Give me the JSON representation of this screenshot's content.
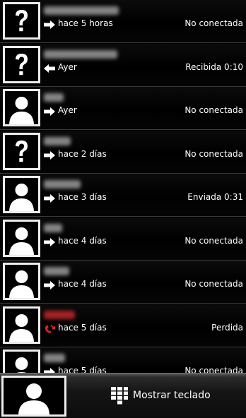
{
  "calls": [
    {
      "avatar": "unknown-contact-icon",
      "direction": "outgoing-call-icon",
      "time": "hace 5 horas",
      "status": "No conectada",
      "missed": false
    },
    {
      "avatar": "unknown-contact-icon",
      "direction": "incoming-call-icon",
      "time": "Ayer",
      "status": "Recibida 0:10",
      "missed": false
    },
    {
      "avatar": "person-silhouette-icon",
      "direction": "outgoing-call-icon",
      "time": "Ayer",
      "status": "No conectada",
      "missed": false
    },
    {
      "avatar": "unknown-contact-icon",
      "direction": "outgoing-call-icon",
      "time": "hace 2 días",
      "status": "No conectada",
      "missed": false
    },
    {
      "avatar": "person-silhouette-icon",
      "direction": "outgoing-call-icon",
      "time": "hace 3 días",
      "status": "Enviada 0:31",
      "missed": false
    },
    {
      "avatar": "person-silhouette-icon",
      "direction": "outgoing-call-icon",
      "time": "hace 4 días",
      "status": "No conectada",
      "missed": false
    },
    {
      "avatar": "person-silhouette-icon",
      "direction": "outgoing-call-icon",
      "time": "hace 4 días",
      "status": "No conectada",
      "missed": false
    },
    {
      "avatar": "person-silhouette-icon",
      "direction": "missed-call-icon",
      "time": "hace 5 días",
      "status": "Perdida",
      "missed": true
    },
    {
      "avatar": "person-silhouette-icon",
      "direction": "outgoing-call-icon",
      "time": "hace 5 días",
      "status": "No conectada",
      "missed": false
    }
  ],
  "bottom_bar": {
    "avatar": "person-silhouette-icon",
    "keypad_icon": "keypad-icon",
    "keypad_label": "Mostrar teclado"
  },
  "colors": {
    "background": "#000000",
    "missed_call": "#d42a2a",
    "avatar_border": "#ececec"
  }
}
